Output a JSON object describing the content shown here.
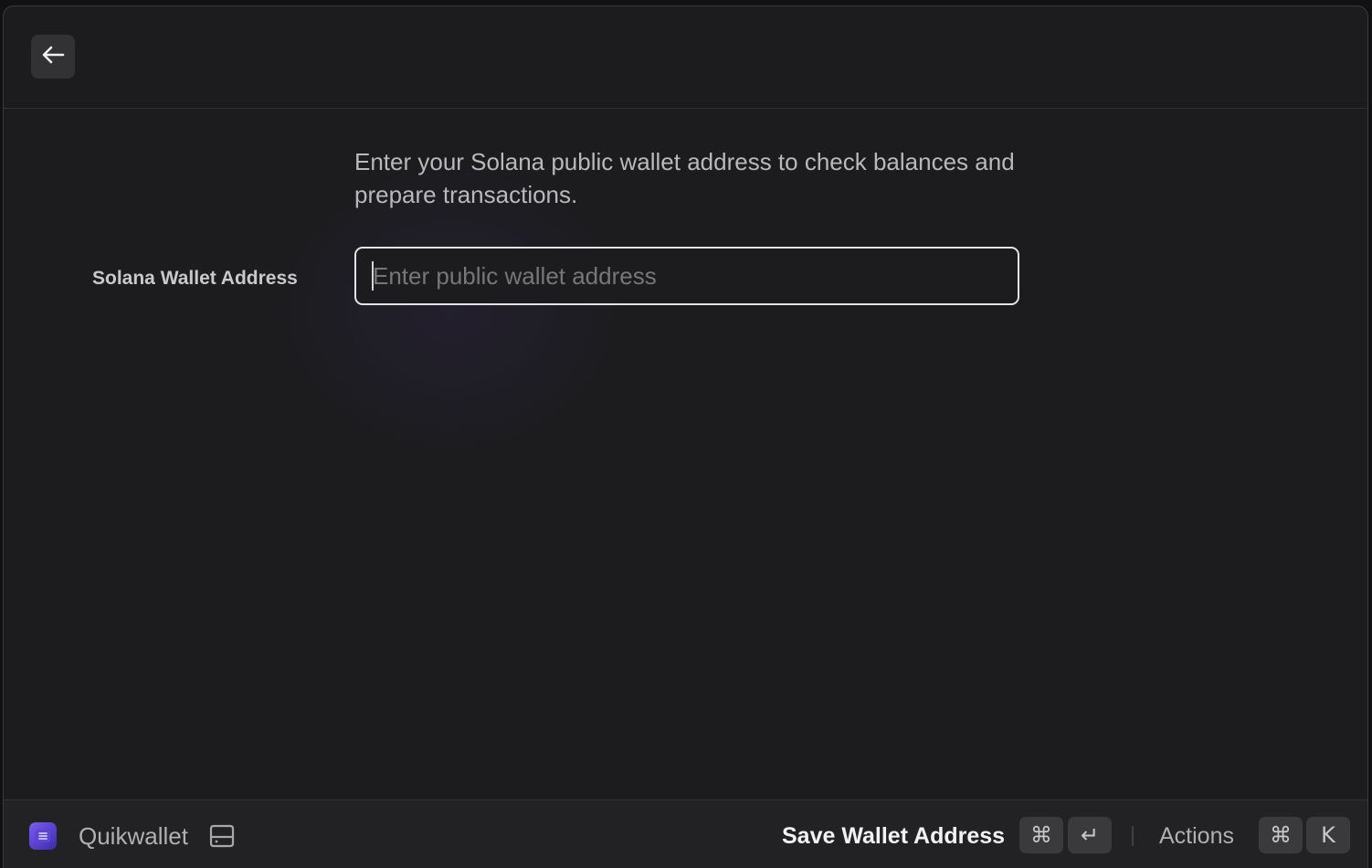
{
  "header": {
    "back_icon": "arrow-left-icon"
  },
  "form": {
    "description": "Enter your Solana public wallet address to check balances and prepare transactions.",
    "field_label": "Solana Wallet Address",
    "input_placeholder": "Enter public wallet address",
    "input_value": ""
  },
  "footer": {
    "app_icon": "quikwallet-app-icon",
    "app_name": "Quikwallet",
    "storage_icon": "hard-drive-icon",
    "primary_action_label": "Save Wallet Address",
    "primary_shortcut": [
      "⌘",
      "↵"
    ],
    "actions_label": "Actions",
    "actions_shortcut": [
      "⌘",
      "K"
    ]
  },
  "colors": {
    "background": "#1c1c1e",
    "footer": "#222224",
    "accent": "#7c5cf0",
    "input_border": "#e4e4e6"
  }
}
